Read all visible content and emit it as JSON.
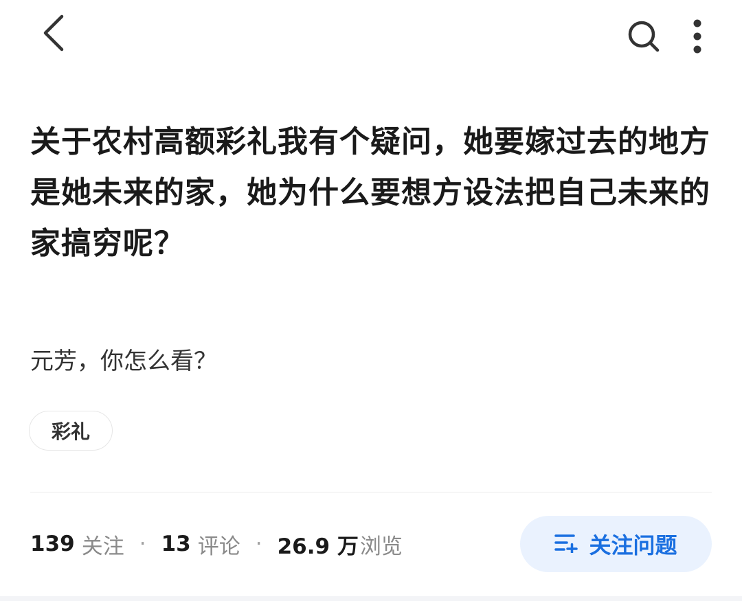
{
  "nav": {
    "back_icon": "chevron-left-icon",
    "search_icon": "search-icon",
    "more_icon": "more-vertical-icon"
  },
  "question": {
    "title": "关于农村高额彩礼我有个疑问，她要嫁过去的地方是她未来的家，她为什么要想方设法把自己未来的家搞穷呢？",
    "description": "元芳，你怎么看？",
    "tags": [
      "彩礼"
    ]
  },
  "stats": {
    "followers_count": "139",
    "followers_label": "关注",
    "comments_count": "13",
    "comments_label": "评论",
    "views_count": "26.9 万",
    "views_label": "浏览",
    "separator": "·"
  },
  "actions": {
    "follow_question_label": "关注问题",
    "follow_icon": "add-to-list-icon"
  },
  "colors": {
    "accent": "#1a6fe0",
    "accent_bg": "#eaf2fe",
    "text_primary": "#1a1a1a",
    "text_secondary": "#8a8a8a"
  }
}
